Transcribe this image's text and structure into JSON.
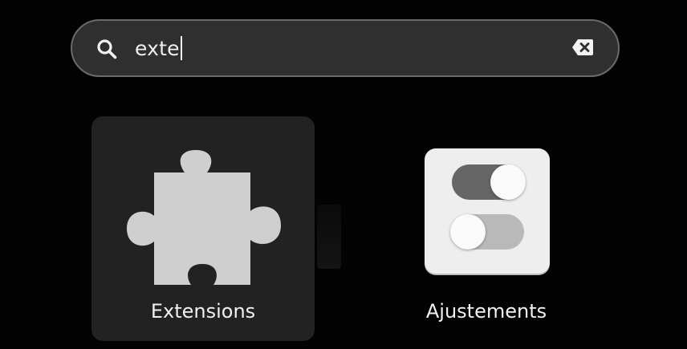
{
  "search": {
    "query": "exte",
    "icon": "search-icon",
    "clear_icon": "clear-input-icon"
  },
  "results": [
    {
      "label": "Extensions",
      "icon": "puzzle-piece-icon",
      "selected": true
    },
    {
      "label": "Ajustements",
      "icon": "toggle-switches-icon",
      "selected": false
    }
  ],
  "colors": {
    "background": "#030303",
    "search_bar": "#2f2f2f",
    "selected_tile": "#222222",
    "text": "#f0f0f0"
  }
}
